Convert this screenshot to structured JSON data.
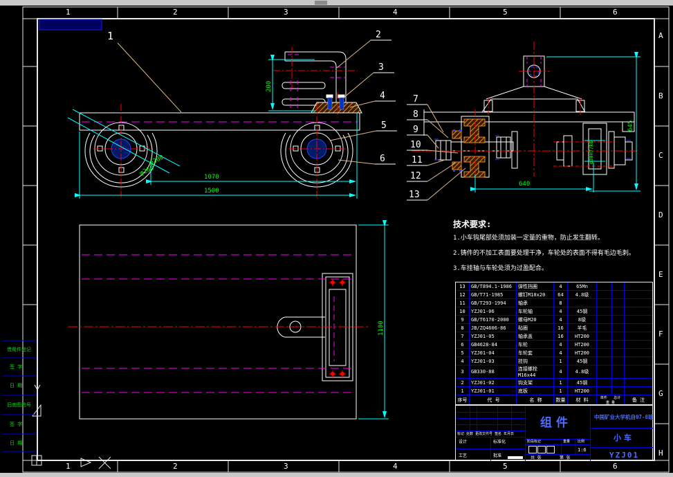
{
  "frame": {
    "top_numbers": [
      "1",
      "2",
      "3",
      "4",
      "5",
      "6"
    ],
    "right_letters": [
      "A",
      "B",
      "C",
      "D",
      "E",
      "F",
      "G",
      "H"
    ]
  },
  "margin": {
    "items": [
      "借用件登记",
      "签  字",
      "日  期",
      "旧底图总号",
      "签  字",
      "日  期"
    ]
  },
  "callouts": {
    "c1": "1",
    "c2": "2",
    "c3": "3",
    "c4": "4",
    "c5": "5",
    "c6": "6",
    "c7": "7",
    "c8": "8",
    "c9": "9",
    "c10": "10",
    "c11": "11",
    "c12": "12",
    "c13": "13"
  },
  "dims": {
    "d200": "200",
    "d1070": "1070",
    "d1500": "1500",
    "phi200": "φ200",
    "phi260": "φ260",
    "d1100": "1100",
    "d640": "640",
    "d645": "645",
    "fit30": "φ30H7/k6"
  },
  "tech": {
    "title": "技术要求:",
    "items": [
      "1.小车钩尾部处须加装一定量的重物，防止发生翻转。",
      "2.铸件的不加工表面要处理干净，车轮处的表面不得有毛边毛刺。",
      "3.车挂轴与车轮处须为过盈配合。"
    ]
  },
  "bom": {
    "headers": {
      "no": "序号",
      "code": "代  号",
      "name": "名  称",
      "qty": "数量",
      "material": "材  料",
      "unit": "单件",
      "total": "总计",
      "weight": "重 量",
      "note": "备  注"
    },
    "rows": [
      {
        "no": "13",
        "code": "GB/T894.1-1986",
        "name": "弹性挡圈",
        "qty": "4",
        "material": "65Mn"
      },
      {
        "no": "12",
        "code": "GB/T71-1985",
        "name": "螺钉M10x20",
        "qty": "64",
        "material": "4.8级"
      },
      {
        "no": "11",
        "code": "GB/T293-1994",
        "name": "轴承",
        "qty": "8",
        "material": ""
      },
      {
        "no": "10",
        "code": "YZJ01-06",
        "name": "车轮轴",
        "qty": "4",
        "material": "45钢"
      },
      {
        "no": "9",
        "code": "GB/T6170-2000",
        "name": "螺母M20",
        "qty": "4",
        "material": "8级"
      },
      {
        "no": "8",
        "code": "JB/ZQ4606-86",
        "name": "毡圈",
        "qty": "16",
        "material": "羊毛"
      },
      {
        "no": "7",
        "code": "YZJ01-05",
        "name": "轴承盖",
        "qty": "16",
        "material": "HT200"
      },
      {
        "no": "6",
        "code": "GB4628-84",
        "name": "车轮",
        "qty": "4",
        "material": "HT200"
      },
      {
        "no": "5",
        "code": "YZJ01-04",
        "name": "车轮套",
        "qty": "4",
        "material": "HT200"
      },
      {
        "no": "4",
        "code": "YZJ01-03",
        "name": "挂钩",
        "qty": "1",
        "material": "45钢"
      },
      {
        "no": "3",
        "code": "GB330-88",
        "name": "连接螺栓M16x44",
        "qty": "4",
        "material": "4.8级"
      },
      {
        "no": "2",
        "code": "YZJ01-02",
        "name": "钩支架",
        "qty": "1",
        "material": "45钢"
      },
      {
        "no": "1",
        "code": "YZJ01-01",
        "name": "底板",
        "qty": "1",
        "material": "HT200"
      }
    ]
  },
  "title_block": {
    "assembly": "组件",
    "org": "中国矿业大学机自07-8班",
    "part": "小车",
    "code": "YZJ01",
    "rev_header": "标记 处数 更改文件号 签名 年月日",
    "design": "设计",
    "standardize": "标准化",
    "process": "工艺",
    "approve": "批准",
    "stage": "阶段标记",
    "weight": "重量",
    "scale_label": "比例",
    "scale": "1:6",
    "sheet": "共 张",
    "page": "第 张"
  },
  "colors": {
    "dimension_text": "#00ff00",
    "dimension_line": "#00ffff",
    "centerline": "#ff0000",
    "hidden_line": "#ff00ff",
    "table_grid": "#0000d8",
    "leader": "#deb887",
    "hatch": "#f08a1e",
    "outline": "#ffffff",
    "title_text": "#4f6bff"
  }
}
